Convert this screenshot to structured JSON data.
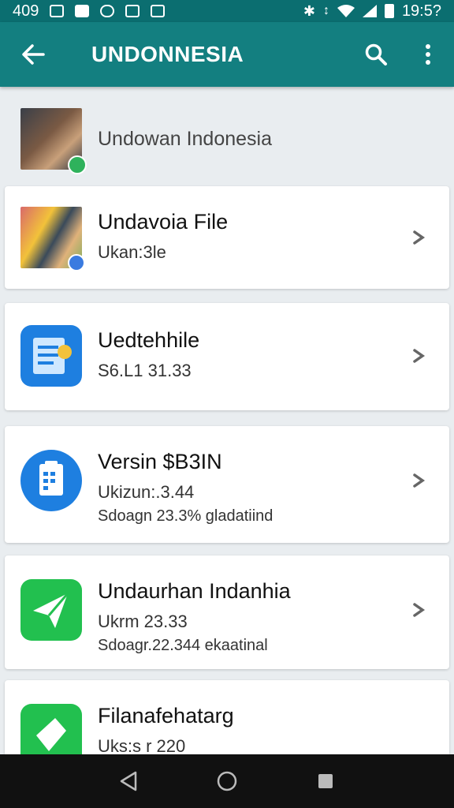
{
  "status_bar": {
    "left_text": "409",
    "time": "19:5?",
    "icons": [
      "email-icon",
      "bag-icon",
      "shield-icon",
      "image-icon",
      "home-icon",
      "bluetooth-icon",
      "vibrate-icon",
      "wifi-icon",
      "signal-icon",
      "battery-icon"
    ]
  },
  "app_bar": {
    "title": "UNDONNESIA",
    "icons": [
      "back-arrow-icon",
      "search-icon",
      "more-vert-icon"
    ]
  },
  "header": {
    "label": "Undowan Indonesia"
  },
  "items": [
    {
      "title": "Undavoia File",
      "subtitle": "Ukan:3le",
      "subtitle2": "",
      "icon": "photo-thumbnail-icon"
    },
    {
      "title": "Uedtehhile",
      "subtitle": "S6.L1 31.33",
      "subtitle2": "",
      "icon": "document-icon"
    },
    {
      "title": "Versin $B3IN",
      "subtitle": "Ukizun:.3.44",
      "subtitle2": "Sdoagn 23.3% gladatiind",
      "icon": "clipboard-icon"
    },
    {
      "title": "Undaurhan Indanhia",
      "subtitle": "Ukrm 23.33",
      "subtitle2": "Sdoagr.22.344 ekaatinal",
      "icon": "send-icon"
    },
    {
      "title": "Filanafehatarg",
      "subtitle": "Uks:s r 220",
      "subtitle2": "",
      "icon": "send-icon"
    }
  ],
  "nav_bar": {
    "icons": [
      "nav-back-icon",
      "nav-home-icon",
      "nav-recents-icon"
    ]
  },
  "colors": {
    "status_bar": "#0b6e70",
    "app_bar": "#137f80",
    "background": "#e9edf0",
    "blue_icon": "#1e7fe0",
    "green_icon": "#22c04f"
  }
}
